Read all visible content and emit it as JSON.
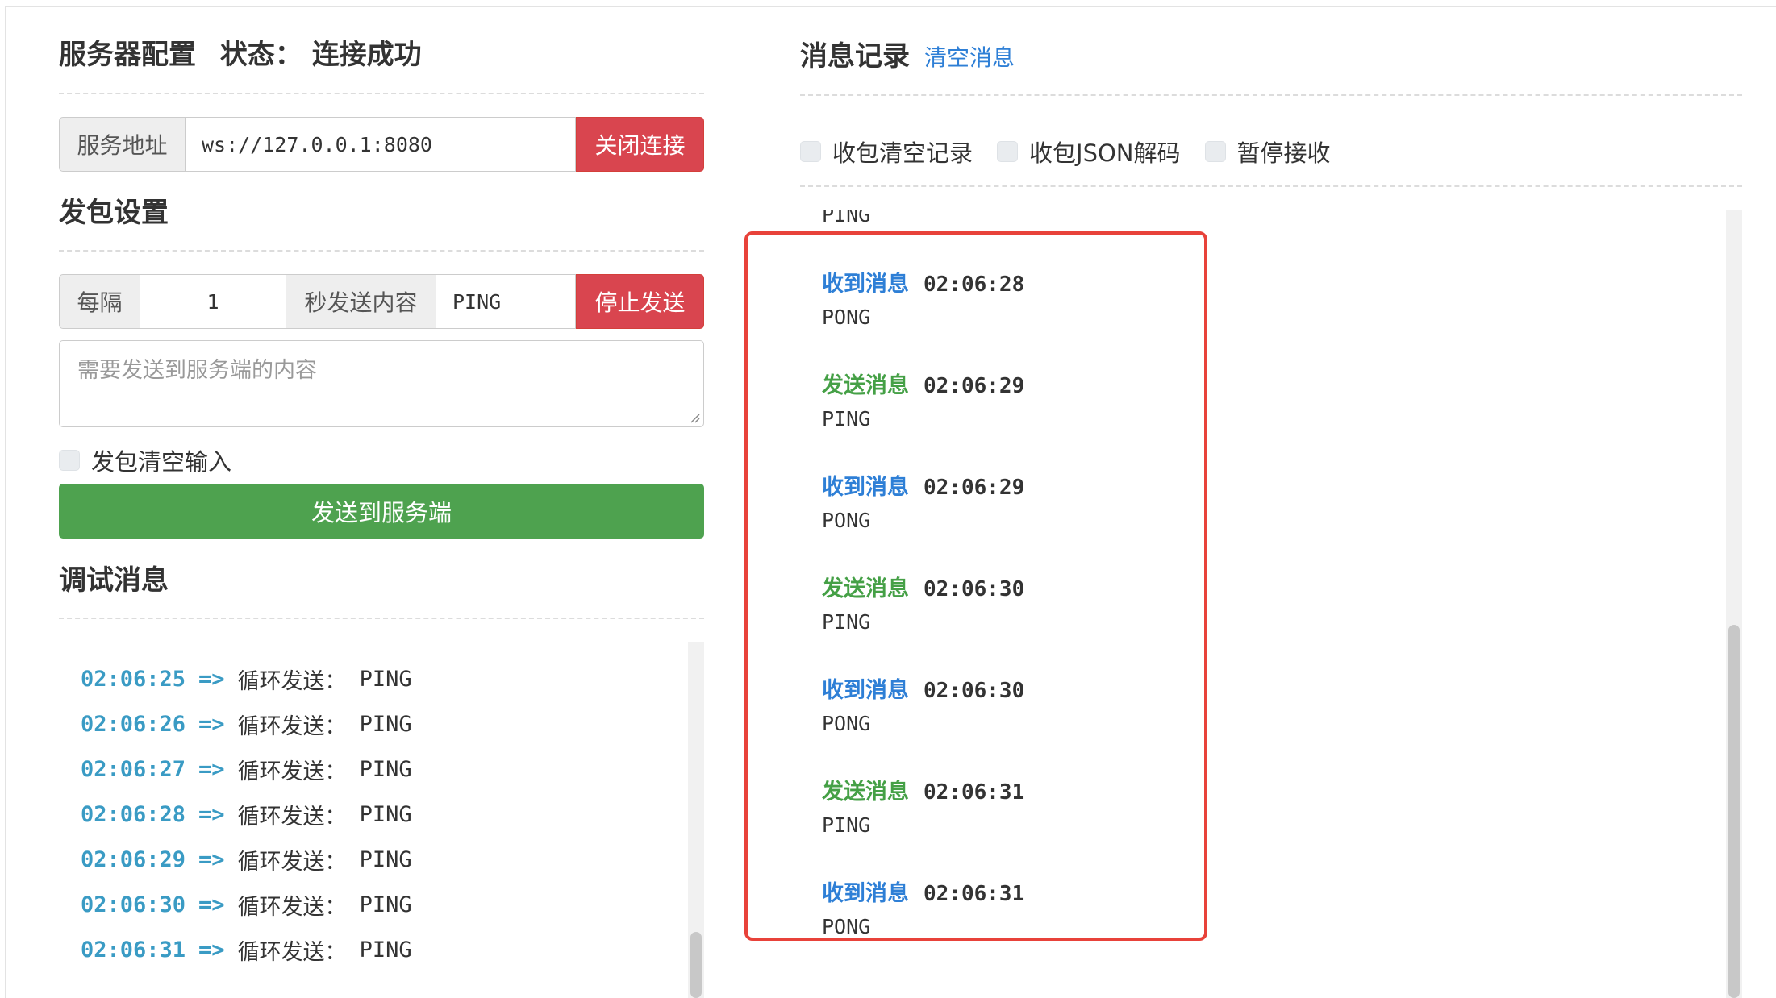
{
  "server": {
    "title": "服务器配置",
    "status_label": "状态：",
    "status_value": "连接成功",
    "address_label": "服务地址",
    "address_value": "ws://127.0.0.1:8080",
    "close_button": "关闭连接"
  },
  "send_settings": {
    "title": "发包设置",
    "every_label": "每隔",
    "interval_value": "1",
    "content_label": "秒发送内容",
    "content_value": "PING",
    "stop_button": "停止发送",
    "textarea_placeholder": "需要发送到服务端的内容",
    "clear_input_label": "发包清空输入",
    "send_button": "发送到服务端"
  },
  "debug": {
    "title": "调试消息",
    "arrow": "=>",
    "lines": [
      {
        "time": "02:06:25",
        "text": "循环发送：",
        "value": "PING"
      },
      {
        "time": "02:06:26",
        "text": "循环发送：",
        "value": "PING"
      },
      {
        "time": "02:06:27",
        "text": "循环发送：",
        "value": "PING"
      },
      {
        "time": "02:06:28",
        "text": "循环发送：",
        "value": "PING"
      },
      {
        "time": "02:06:29",
        "text": "循环发送：",
        "value": "PING"
      },
      {
        "time": "02:06:30",
        "text": "循环发送：",
        "value": "PING"
      },
      {
        "time": "02:06:31",
        "text": "循环发送：",
        "value": "PING"
      }
    ]
  },
  "messages": {
    "title": "消息记录",
    "clear_link": "清空消息",
    "options": [
      "收包清空记录",
      "收包JSON解码",
      "暂停接收"
    ],
    "partial_top": "PING",
    "entries": [
      {
        "type": "recv",
        "label": "收到消息",
        "time": "02:06:28",
        "body": "PONG"
      },
      {
        "type": "send",
        "label": "发送消息",
        "time": "02:06:29",
        "body": "PING"
      },
      {
        "type": "recv",
        "label": "收到消息",
        "time": "02:06:29",
        "body": "PONG"
      },
      {
        "type": "send",
        "label": "发送消息",
        "time": "02:06:30",
        "body": "PING"
      },
      {
        "type": "recv",
        "label": "收到消息",
        "time": "02:06:30",
        "body": "PONG"
      },
      {
        "type": "send",
        "label": "发送消息",
        "time": "02:06:31",
        "body": "PING"
      },
      {
        "type": "recv",
        "label": "收到消息",
        "time": "02:06:31",
        "body": "PONG"
      }
    ]
  },
  "colors": {
    "recv": "#2e7fd6",
    "send": "#45a046",
    "danger": "#d9454f",
    "success": "#4ea24f",
    "highlight": "#e8423a"
  }
}
